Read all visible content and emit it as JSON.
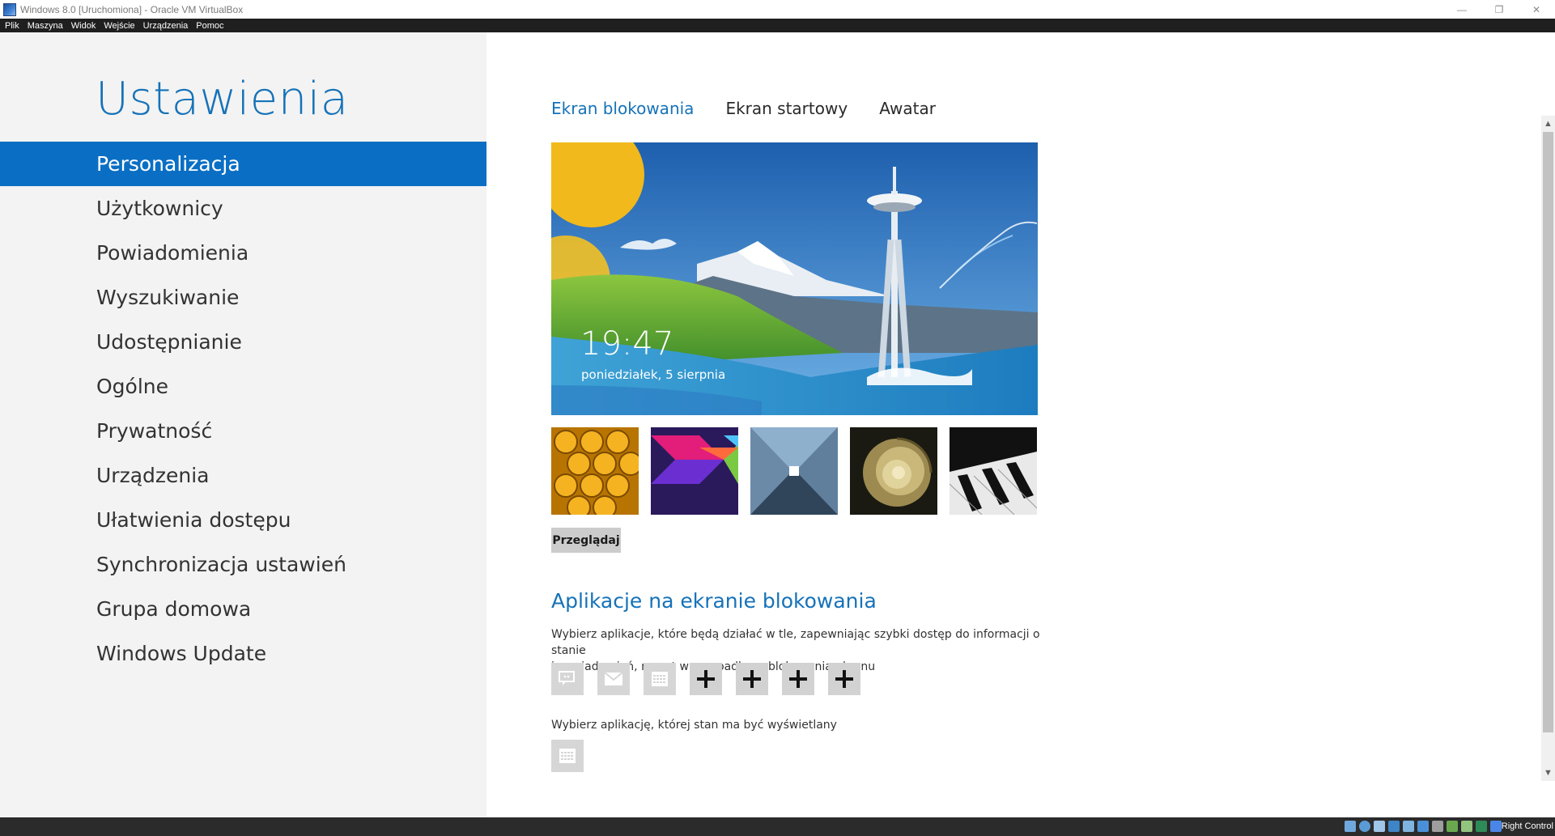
{
  "host": {
    "title": "Windows 8.0 [Uruchomiona] - Oracle VM VirtualBox",
    "menu": [
      "Plik",
      "Maszyna",
      "Widok",
      "Wejście",
      "Urządzenia",
      "Pomoc"
    ],
    "window_controls": {
      "minimize": "—",
      "restore": "❐",
      "close": "✕"
    },
    "host_key": "Right Control",
    "status_icons": [
      "hard-disk-icon",
      "optical-drive-icon",
      "audio-icon",
      "network-icon",
      "usb-icon",
      "shared-folders-icon",
      "display-icon",
      "video-capture-icon",
      "mouse-integration-icon",
      "cpu-icon",
      "arrow-down-icon"
    ]
  },
  "sidebar": {
    "title": "Ustawienia",
    "items": [
      {
        "label": "Personalizacja",
        "active": true
      },
      {
        "label": "Użytkownicy"
      },
      {
        "label": "Powiadomienia"
      },
      {
        "label": "Wyszukiwanie"
      },
      {
        "label": "Udostępnianie"
      },
      {
        "label": "Ogólne"
      },
      {
        "label": "Prywatność"
      },
      {
        "label": "Urządzenia"
      },
      {
        "label": "Ułatwienia dostępu"
      },
      {
        "label": "Synchronizacja ustawień"
      },
      {
        "label": "Grupa domowa"
      },
      {
        "label": "Windows Update"
      }
    ]
  },
  "tabs": [
    {
      "label": "Ekran blokowania",
      "active": true
    },
    {
      "label": "Ekran startowy"
    },
    {
      "label": "Awatar"
    }
  ],
  "preview": {
    "time": "19:47",
    "date": "poniedziałek, 5 sierpnia"
  },
  "thumbnails": [
    "honeycomb",
    "colorful-shapes",
    "tunnel",
    "nautilus-shell",
    "piano-keys"
  ],
  "browse_label": "Przeglądaj",
  "apps": {
    "heading": "Aplikacje na ekranie blokowania",
    "description_line1": "Wybierz aplikacje, które będą działać w tle, zapewniając szybki dostęp do informacji o stanie",
    "description_line2": "i powiadomień, nawet w przypadku zablokowania ekranu",
    "slots": [
      "messaging-icon",
      "mail-icon",
      "calendar-icon",
      "add",
      "add",
      "add",
      "add"
    ],
    "add_symbol": "+",
    "status_description": "Wybierz aplikację, której stan ma być wyświetlany",
    "status_slot": "calendar-icon"
  },
  "scrollbar": {
    "up": "▲",
    "down": "▼"
  },
  "colors": {
    "accent": "#1672b8",
    "selection": "#0a6fc4",
    "sidebar_bg": "#f3f3f3"
  }
}
